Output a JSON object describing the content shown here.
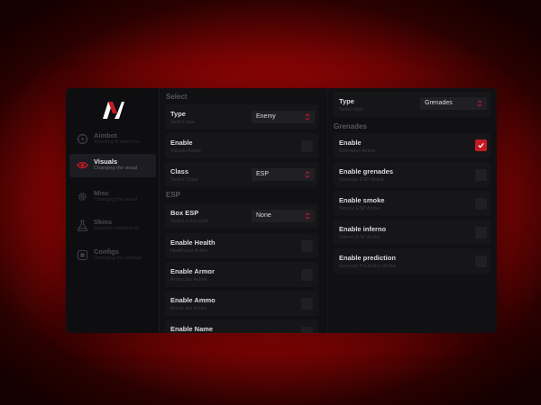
{
  "colors": {
    "accent": "#c41a24",
    "window_bg": "#111114",
    "row_bg": "#161619"
  },
  "sidebar": {
    "items": [
      {
        "title": "Aimbot",
        "subtitle": "Shooting in men's ho",
        "icon": "crosshair-icon",
        "active": false
      },
      {
        "title": "Visuals",
        "subtitle": "Changing the visual",
        "icon": "eye-icon",
        "active": true
      },
      {
        "title": "Misc",
        "subtitle": "Changing the visual",
        "icon": "gear-icon",
        "active": false
      },
      {
        "title": "Skins",
        "subtitle": "Function contains ch",
        "icon": "flask-icon",
        "active": false
      },
      {
        "title": "Configs",
        "subtitle": "Changing the settings",
        "icon": "box-icon",
        "active": false
      }
    ]
  },
  "left": {
    "select_section": "Select",
    "esp_section": "ESP",
    "type": {
      "label": "Type",
      "sub": "Select type",
      "value": "Enemy"
    },
    "enable": {
      "label": "Enable",
      "sub": "Visuals Active",
      "checked": false
    },
    "class": {
      "label": "Class",
      "sub": "Select Class",
      "value": "ESP"
    },
    "box_esp": {
      "label": "Box ESP",
      "sub": "Select a box type",
      "value": "None"
    },
    "enable_health": {
      "label": "Enable Health",
      "sub": "Health bar Active",
      "checked": false
    },
    "enable_armor": {
      "label": "Enable Armor",
      "sub": "Armor bar Active",
      "checked": false
    },
    "enable_ammo": {
      "label": "Enable Ammo",
      "sub": "Armor bar Active",
      "checked": false
    },
    "enable_name": {
      "label": "Enable Name",
      "sub": "",
      "checked": false
    }
  },
  "right": {
    "type": {
      "label": "Type",
      "sub": "Select type",
      "value": "Grenades"
    },
    "grenades_section": "Grenades",
    "enable": {
      "label": "Enable",
      "sub": "Grenades Active",
      "checked": true
    },
    "enable_grenades": {
      "label": "Enable grenades",
      "sub": "Grenade ESP Active",
      "checked": false
    },
    "enable_smoke": {
      "label": "Enable smoke",
      "sub": "Smoke ESP Active",
      "checked": false
    },
    "enable_inferno": {
      "label": "Enable inferno",
      "sub": "Inferno ESP Active",
      "checked": false
    },
    "enable_prediction": {
      "label": "Enable prediction",
      "sub": "Grenade Prediction Active",
      "checked": false
    }
  }
}
